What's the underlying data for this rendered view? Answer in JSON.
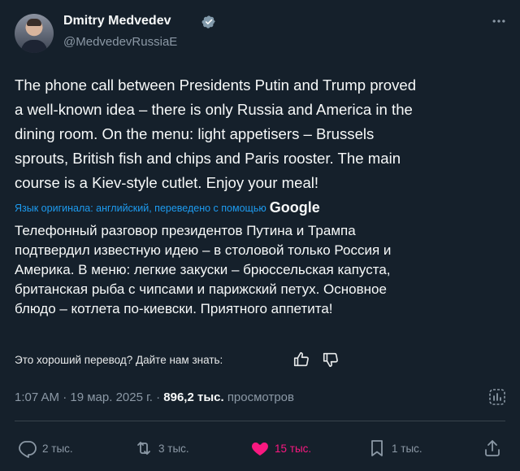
{
  "author": {
    "name": "Dmitry Medvedev",
    "handle": "@MedvedevRussiaE",
    "verified": true
  },
  "tweet_text": "The phone call between Presidents Putin and Trump proved\na well-known idea – there is only Russia and America in the\ndining room. On the menu: light appetisers – Brussels\nsprouts, British fish and chips and Paris rooster. The main\ncourse is a Kiev-style cutlet. Enjoy your meal!",
  "translation_note": {
    "text": "Язык оригинала: английский, переведено с помощью",
    "provider": "Google"
  },
  "translation_text": "Телефонный разговор президентов Путина и Трампа\nподтвердил известную идею – в столовой только Россия и\nАмерика. В меню: легкие закуски – брюссельская капуста,\nбританская рыба с чипсами и парижский петух. Основное\nблюдо – котлета по-киевски. Приятного аппетита!",
  "feedback": {
    "prompt": "Это хороший перевод? Дайте нам знать:"
  },
  "meta": {
    "time": "1:07 AM",
    "separator": "·",
    "date": "19 мар. 2025 г.",
    "views_count": "896,2 тыс.",
    "views_label": "просмотров"
  },
  "actions": {
    "replies": "2 тыс.",
    "reposts": "3 тыс.",
    "likes": "15 тыс.",
    "bookmarks": "1 тыс."
  },
  "colors": {
    "background": "#15202b",
    "text": "#f7f9f9",
    "muted": "#8b98a5",
    "accent_blue": "#1d9bf0",
    "like_pink": "#f91880"
  },
  "icons": [
    "verified-badge-icon",
    "more-options-icon",
    "thumbs-up-icon",
    "thumbs-down-icon",
    "analytics-icon",
    "reply-icon",
    "repost-icon",
    "like-heart-icon",
    "bookmark-icon",
    "share-icon"
  ]
}
